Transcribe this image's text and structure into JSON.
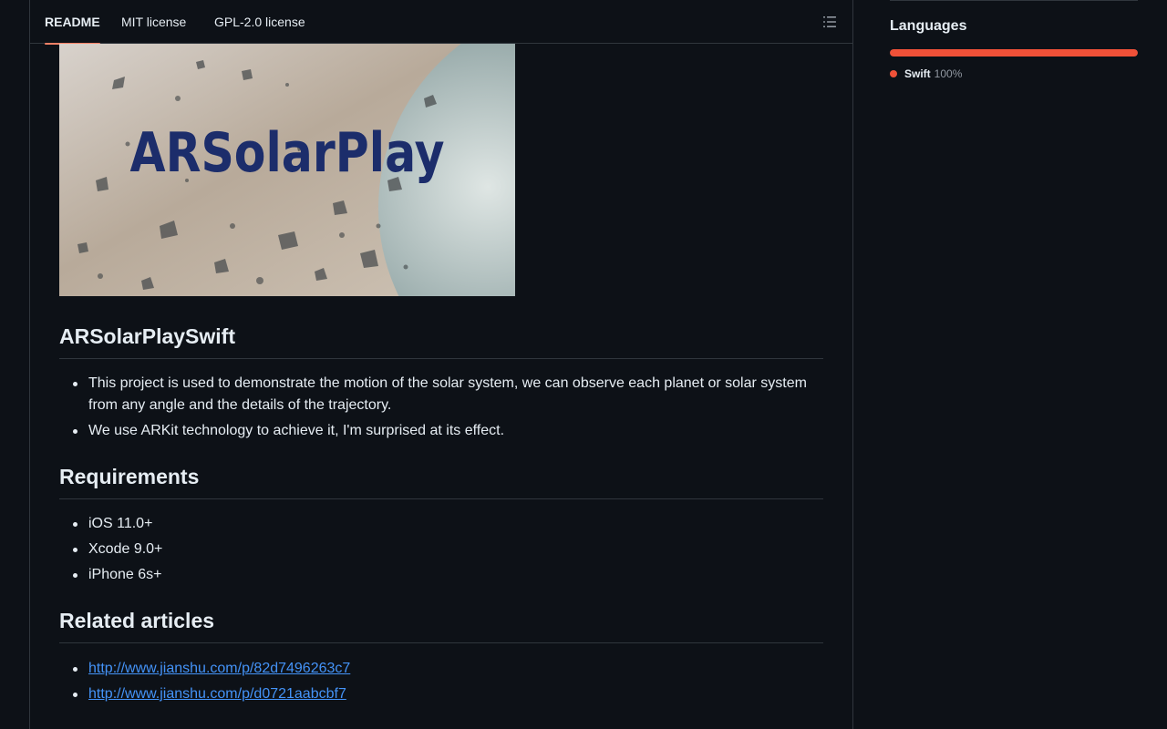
{
  "tabs": [
    {
      "label": "README",
      "active": true
    },
    {
      "label": "MIT license",
      "active": false
    },
    {
      "label": "GPL-2.0 license",
      "active": false
    }
  ],
  "icons": {
    "toc": "list-unordered-icon"
  },
  "hero": {
    "text": "ARSolarPlay"
  },
  "readme": {
    "sections": [
      {
        "heading": "ARSolarPlaySwift",
        "items": [
          "This project is used to demonstrate the motion of the solar system, we can observe each planet or solar system from any angle and the details of the trajectory.",
          "We use ARKit technology to achieve it, I'm surprised at its effect."
        ]
      },
      {
        "heading": "Requirements",
        "items": [
          "iOS 11.0+",
          "Xcode 9.0+",
          "iPhone 6s+"
        ]
      },
      {
        "heading": "Related articles",
        "links": [
          "http://www.jianshu.com/p/82d7496263c7",
          "http://www.jianshu.com/p/d0721aabcbf7"
        ]
      }
    ]
  },
  "sidebar": {
    "languages_title": "Languages",
    "languages": [
      {
        "name": "Swift",
        "percent": "100%",
        "fraction": 1.0,
        "color": "#F05138"
      }
    ]
  },
  "colors": {
    "background": "#0d1117",
    "border": "#30363d",
    "accent_tab": "#f78166",
    "link": "#4493f8"
  }
}
